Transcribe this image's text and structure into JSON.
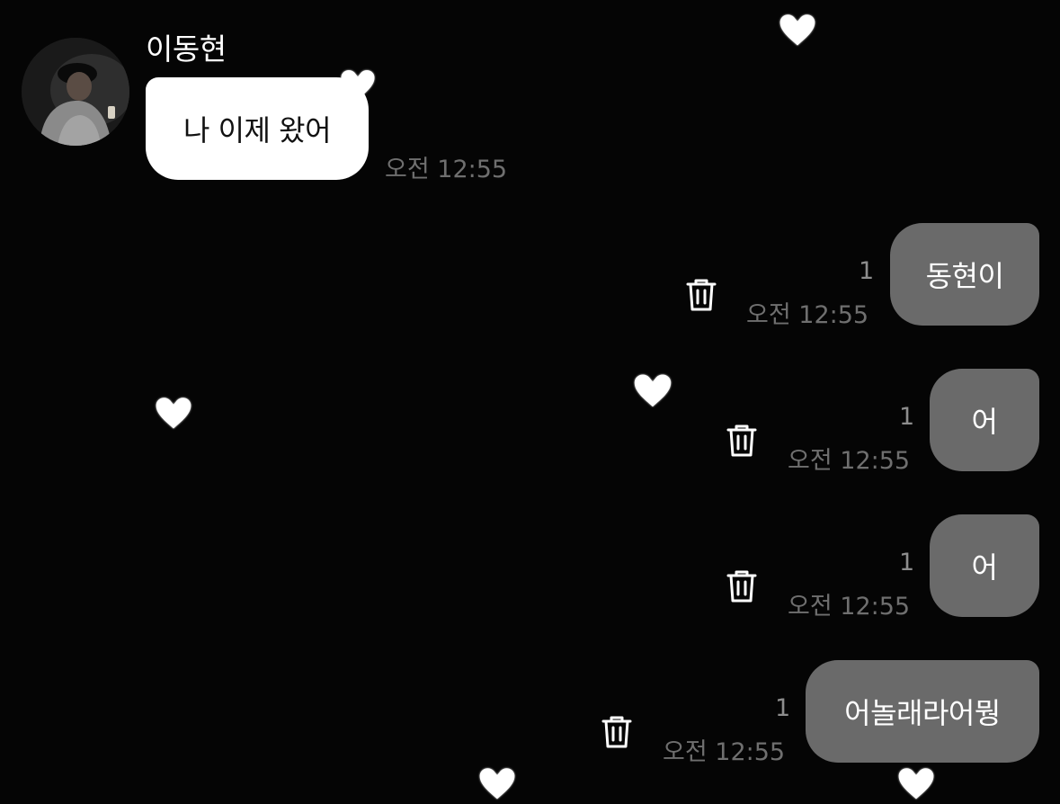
{
  "colors": {
    "background": "#050505",
    "incoming_bubble": "#ffffff",
    "outgoing_bubble": "#6a6a6a",
    "timestamp": "#6f6f6f"
  },
  "conversation": {
    "contact_name": "이동현",
    "incoming": {
      "text": "나 이제 왔어",
      "time": "오전 12:55"
    },
    "outgoing": [
      {
        "text": "동현이",
        "time": "오전 12:55",
        "unread": "1"
      },
      {
        "text": "어",
        "time": "오전 12:55",
        "unread": "1"
      },
      {
        "text": "어",
        "time": "오전 12:55",
        "unread": "1"
      },
      {
        "text": "어놀래라어뭥",
        "time": "오전 12:55",
        "unread": "1"
      }
    ]
  },
  "icons": {
    "delete": "trash-icon",
    "decoration": "heart-icon"
  }
}
